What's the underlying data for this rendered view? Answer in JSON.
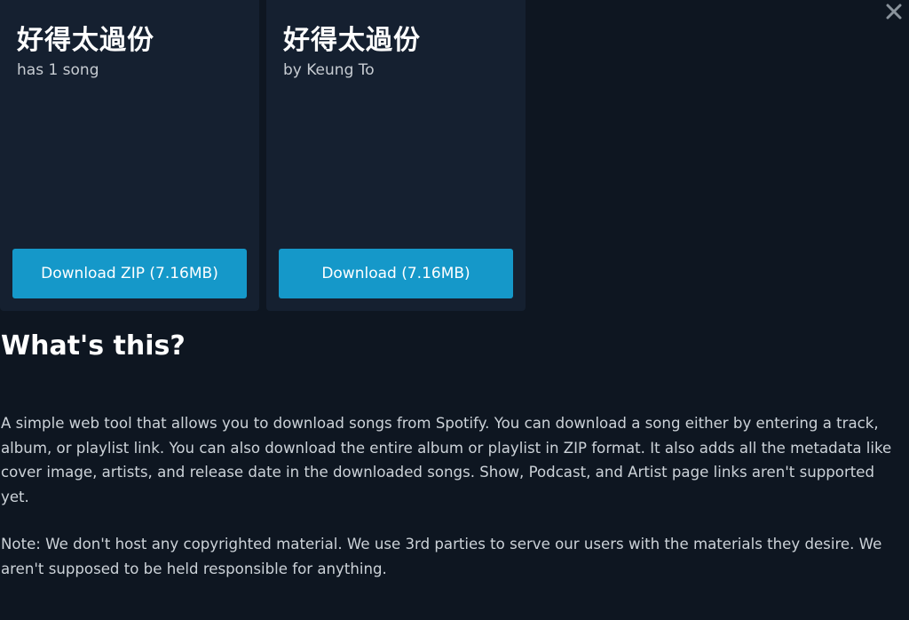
{
  "colors": {
    "background": "#0e1621",
    "card": "#152030",
    "accent_button": "#1598c9",
    "text_primary": "#ffffff"
  },
  "dialog": {
    "close_icon": "close-x-icon"
  },
  "cards": [
    {
      "title": "好得太過份",
      "subtitle": "has 1 song",
      "button_label": "Download ZIP (7.16MB)"
    },
    {
      "title": "好得太過份",
      "subtitle": "by Keung To",
      "button_label": "Download (7.16MB)"
    }
  ],
  "about": {
    "heading": "What's this?",
    "paragraph_1": "A simple web tool that allows you to download songs from Spotify. You can download a song either by entering a track, album, or playlist link. You can also download the entire album or playlist in ZIP format. It also adds all the metadata like cover image, artists, and release date in the downloaded songs. Show, Podcast, and Artist page links aren't supported yet.",
    "paragraph_2": "Note: We don't host any copyrighted material. We use 3rd parties to serve our users with the materials they desire. We aren't supposed to be held responsible for anything."
  }
}
